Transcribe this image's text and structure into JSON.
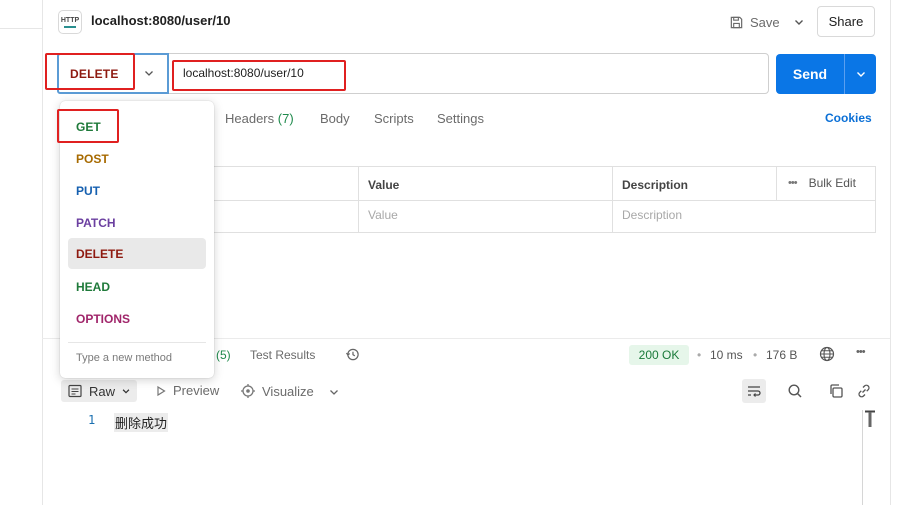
{
  "header": {
    "request_title": "localhost:8080/user/10",
    "save_label": "Save",
    "share_label": "Share"
  },
  "request": {
    "method": "DELETE",
    "url": "localhost:8080/user/10",
    "send_label": "Send"
  },
  "tabs": [
    {
      "label": "Headers",
      "count": "(7)"
    },
    {
      "label": "Body"
    },
    {
      "label": "Scripts"
    },
    {
      "label": "Settings"
    }
  ],
  "cookies_label": "Cookies",
  "params_table": {
    "headers": [
      "Value",
      "Description"
    ],
    "bulk_edit_label": "Bulk Edit",
    "placeholders": {
      "value": "Value",
      "description": "Description"
    }
  },
  "method_menu": {
    "items": [
      {
        "label": "GET",
        "color": "#1f7a3a"
      },
      {
        "label": "POST",
        "color": "#a76a00"
      },
      {
        "label": "PUT",
        "color": "#1660b0"
      },
      {
        "label": "PATCH",
        "color": "#6b3fa0"
      },
      {
        "label": "DELETE",
        "color": "#8e1a10",
        "selected": true
      },
      {
        "label": "HEAD",
        "color": "#1f7a3a"
      },
      {
        "label": "OPTIONS",
        "color": "#a0256a"
      }
    ],
    "new_method_placeholder": "Type a new method"
  },
  "response": {
    "tabs_partial_count": "(5)",
    "test_results_label": "Test Results",
    "status": "200 OK",
    "time": "10 ms",
    "size": "176 B",
    "view_mode": "Raw",
    "preview_label": "Preview",
    "visualize_label": "Visualize",
    "body_lines": [
      {
        "number": "1",
        "text": "删除成功"
      }
    ]
  },
  "colors": {
    "accent": "#0a76e6",
    "annotation_red": "#e02020",
    "method_delete": "#8e1a10",
    "status_ok": "#1a7a3a"
  }
}
